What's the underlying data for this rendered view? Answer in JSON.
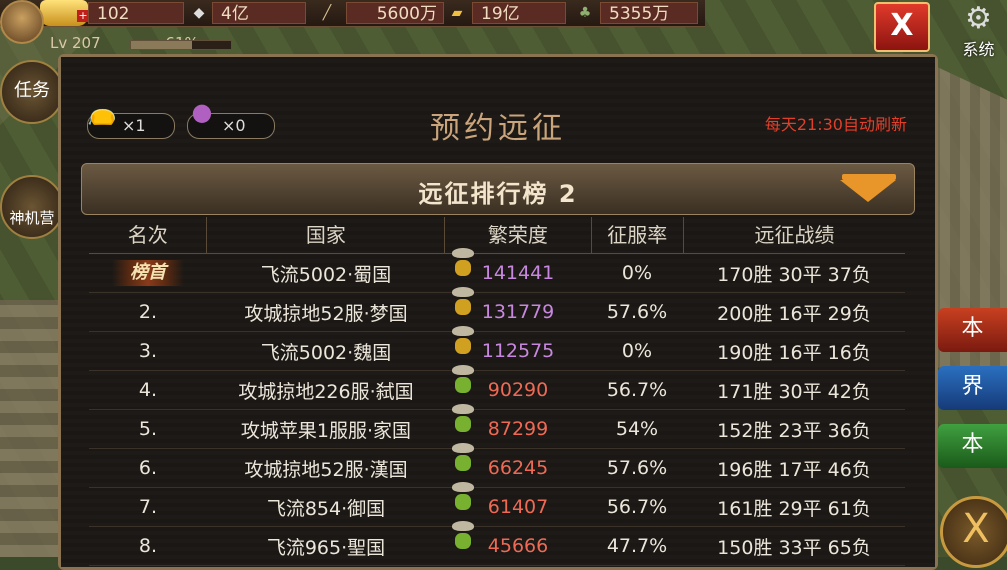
{
  "topbar": {
    "level_text": "Lv 207",
    "level_percent_text": "61%",
    "level_progress": 0.61,
    "resources": [
      {
        "name": "gold",
        "value": "102",
        "icon": "gold-ingot-icon"
      },
      {
        "name": "silver",
        "value": "4亿",
        "icon": "silver-ingot-icon"
      },
      {
        "name": "wood",
        "value": "5600万",
        "icon": "wood-icon"
      },
      {
        "name": "gold-bar",
        "value": "19亿",
        "icon": "gold-bar-icon"
      },
      {
        "name": "food",
        "value": "5355万",
        "icon": "food-icon"
      }
    ]
  },
  "left_sidebar": {
    "task_label": "任务",
    "shenji_label": "神机营"
  },
  "right_sidebar": {
    "system_label": "系统",
    "tab1_label": "本",
    "tab2_label": "界",
    "tab3_label": "本"
  },
  "panel": {
    "title": "预约远征",
    "refresh_note": "每天21:30自动刷新",
    "item1_count": "×1",
    "item2_count": "×0",
    "ranking_title": "远征排行榜 2",
    "columns": {
      "rank": "名次",
      "country": "国家",
      "prosperity": "繁荣度",
      "conquest_rate": "征服率",
      "record": "远征战绩"
    },
    "rows": [
      {
        "rank": "榜首",
        "country": "飞流5002·蜀国",
        "prosperity": "141441",
        "rate": "0%",
        "record": "170胜 30平 37负",
        "color": "#c888e0",
        "ingot": "#d0a020"
      },
      {
        "rank": "2.",
        "country": "攻城掠地52服·梦国",
        "prosperity": "131779",
        "rate": "57.6%",
        "record": "200胜 16平 29负",
        "color": "#c888e0",
        "ingot": "#d0a020"
      },
      {
        "rank": "3.",
        "country": "飞流5002·魏国",
        "prosperity": "112575",
        "rate": "0%",
        "record": "190胜 16平 16负",
        "color": "#c888e0",
        "ingot": "#d0a020"
      },
      {
        "rank": "4.",
        "country": "攻城掠地226服·弑国",
        "prosperity": "90290",
        "rate": "56.7%",
        "record": "171胜 30平 42负",
        "color": "#ee6a55",
        "ingot": "#78b030"
      },
      {
        "rank": "5.",
        "country": "攻城苹果1服服·家国",
        "prosperity": "87299",
        "rate": "54%",
        "record": "152胜 23平 36负",
        "color": "#ee6a55",
        "ingot": "#78b030"
      },
      {
        "rank": "6.",
        "country": "攻城掠地52服·漢国",
        "prosperity": "66245",
        "rate": "57.6%",
        "record": "196胜 17平 46负",
        "color": "#ee6a55",
        "ingot": "#78b030"
      },
      {
        "rank": "7.",
        "country": "飞流854·御国",
        "prosperity": "61407",
        "rate": "56.7%",
        "record": "161胜 29平 61负",
        "color": "#ee6a55",
        "ingot": "#78b030"
      },
      {
        "rank": "8.",
        "country": "飞流965·聖国",
        "prosperity": "45666",
        "rate": "47.7%",
        "record": "150胜 33平 65负",
        "color": "#ee6a55",
        "ingot": "#78b030"
      }
    ]
  },
  "buttons": {
    "close_top": "X",
    "close_corner": "X"
  }
}
